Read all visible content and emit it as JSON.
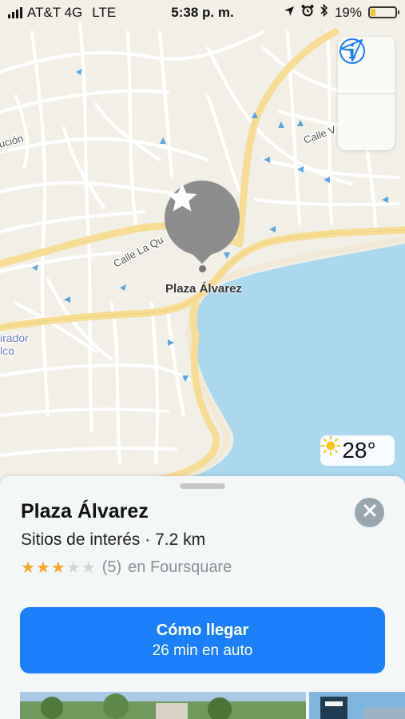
{
  "status_bar": {
    "carrier": "AT&T 4G",
    "network": "LTE",
    "time": "5:38 p. m.",
    "battery": "19%",
    "battery_level": 0.19
  },
  "map": {
    "street_labels": [
      "Calle La Qu",
      "Calle V",
      "ución",
      "irador",
      "lco"
    ],
    "pin_label": "Plaza Álvarez",
    "pin_icon": "star-icon",
    "colors": {
      "land": "#f2efe6",
      "water": "#aad8ef",
      "major_road": "#f7dc94",
      "minor_road": "#ffffff",
      "oneway_arrow": "#5aa6e0"
    }
  },
  "map_controls": {
    "info_icon": "info-icon",
    "location_icon": "location-arrow-icon",
    "accent": "#1a7ff8"
  },
  "weather": {
    "icon": "sun-icon",
    "temperature": "28°"
  },
  "place_card": {
    "title": "Plaza Álvarez",
    "subtitle": "Sitios de interés · 7.2 km",
    "rating_filled": 3,
    "rating_total": 5,
    "review_count": "(5)",
    "source": "en Foursquare",
    "directions_label": "Cómo llegar",
    "directions_detail": "26 min en auto"
  }
}
